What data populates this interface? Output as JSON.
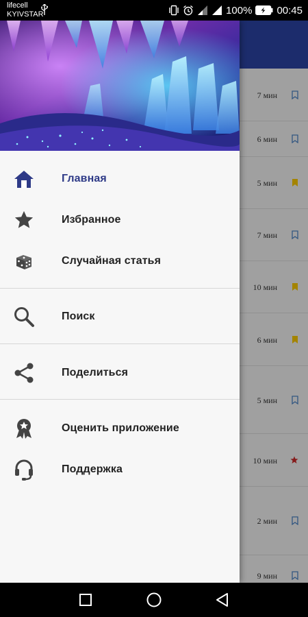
{
  "status_bar": {
    "carrier_line1": "lifecell",
    "carrier_line2": "KYIVSTAR",
    "battery_percent": "100%",
    "time": "00:45",
    "icons": [
      "usb-icon",
      "vibrate-icon",
      "alarm-icon",
      "signal-icon",
      "signal-icon",
      "battery-icon"
    ]
  },
  "drawer": {
    "header_image": "crystal-cave-image",
    "accent_color": "#2e3a87",
    "sections": [
      [
        {
          "label": "Главная",
          "icon": "home-icon",
          "active": true
        },
        {
          "label": "Избранное",
          "icon": "star-icon",
          "active": false
        },
        {
          "label": "Случайная статья",
          "icon": "dice-icon",
          "active": false
        }
      ],
      [
        {
          "label": "Поиск",
          "icon": "search-icon",
          "active": false
        }
      ],
      [
        {
          "label": "Поделиться",
          "icon": "share-icon",
          "active": false
        }
      ],
      [
        {
          "label": "Оценить приложение",
          "icon": "award-icon",
          "active": false
        },
        {
          "label": "Поддержка",
          "icon": "headset-icon",
          "active": false
        }
      ]
    ]
  },
  "article_list": {
    "items": [
      {
        "time": "7 мин",
        "bookmark": "outline"
      },
      {
        "time": "6 мин",
        "bookmark": "outline"
      },
      {
        "time": "5 мин",
        "bookmark": "filled-yellow"
      },
      {
        "time": "7 мин",
        "bookmark": "outline"
      },
      {
        "time": "10 мин",
        "bookmark": "filled-yellow"
      },
      {
        "time": "6 мин",
        "bookmark": "filled-yellow"
      },
      {
        "time": "5 мин",
        "bookmark": "outline"
      },
      {
        "time": "10 мин",
        "bookmark": "star-red"
      },
      {
        "time": "2 мин",
        "bookmark": "outline"
      },
      {
        "time": "9 мин",
        "bookmark": "outline"
      }
    ]
  },
  "nav_bar": {
    "buttons": [
      "recents-button",
      "home-button",
      "back-button"
    ]
  }
}
